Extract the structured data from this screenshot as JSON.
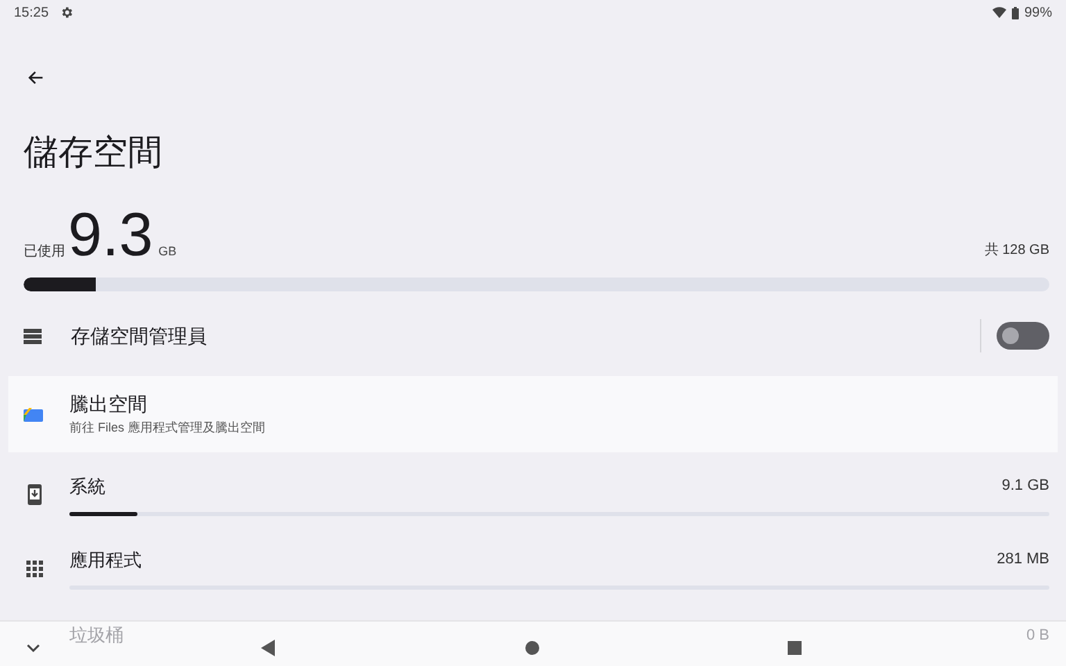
{
  "status_bar": {
    "time": "15:25",
    "battery": "99%"
  },
  "title": "儲存空間",
  "usage": {
    "used_label": "已使用",
    "used_value": "9.3",
    "used_unit": "GB",
    "total": "共 128 GB",
    "level": 0.07
  },
  "storage_manager": {
    "label": "存儲空間管理員",
    "on": false
  },
  "free_up": {
    "title": "騰出空間",
    "subtitle": "前往 Files 應用程式管理及騰出空間"
  },
  "categories": [
    {
      "kind": "system",
      "label": "系統",
      "size": "9.1 GB",
      "level": 0.07
    },
    {
      "kind": "apps",
      "label": "應用程式",
      "size": "281 MB",
      "level": 0
    },
    {
      "kind": "trash",
      "label": "垃圾桶",
      "size": "0 B"
    }
  ]
}
